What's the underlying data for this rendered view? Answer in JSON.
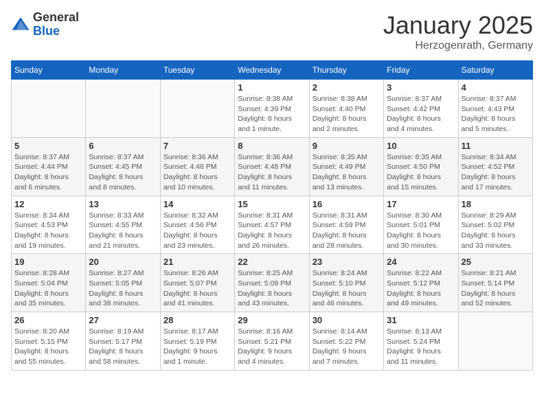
{
  "header": {
    "logo_line1": "General",
    "logo_line2": "Blue",
    "title": "January 2025",
    "subtitle": "Herzogenrath, Germany"
  },
  "weekdays": [
    "Sunday",
    "Monday",
    "Tuesday",
    "Wednesday",
    "Thursday",
    "Friday",
    "Saturday"
  ],
  "weeks": [
    {
      "days": [
        {
          "number": "",
          "info": "",
          "empty": true
        },
        {
          "number": "",
          "info": "",
          "empty": true
        },
        {
          "number": "",
          "info": "",
          "empty": true
        },
        {
          "number": "1",
          "info": "Sunrise: 8:38 AM\nSunset: 4:39 PM\nDaylight: 8 hours\nand 1 minute."
        },
        {
          "number": "2",
          "info": "Sunrise: 8:38 AM\nSunset: 4:40 PM\nDaylight: 8 hours\nand 2 minutes."
        },
        {
          "number": "3",
          "info": "Sunrise: 8:37 AM\nSunset: 4:42 PM\nDaylight: 8 hours\nand 4 minutes."
        },
        {
          "number": "4",
          "info": "Sunrise: 8:37 AM\nSunset: 4:43 PM\nDaylight: 8 hours\nand 5 minutes."
        }
      ]
    },
    {
      "days": [
        {
          "number": "5",
          "info": "Sunrise: 8:37 AM\nSunset: 4:44 PM\nDaylight: 8 hours\nand 6 minutes."
        },
        {
          "number": "6",
          "info": "Sunrise: 8:37 AM\nSunset: 4:45 PM\nDaylight: 8 hours\nand 8 minutes."
        },
        {
          "number": "7",
          "info": "Sunrise: 8:36 AM\nSunset: 4:46 PM\nDaylight: 8 hours\nand 10 minutes."
        },
        {
          "number": "8",
          "info": "Sunrise: 8:36 AM\nSunset: 4:48 PM\nDaylight: 8 hours\nand 11 minutes."
        },
        {
          "number": "9",
          "info": "Sunrise: 8:35 AM\nSunset: 4:49 PM\nDaylight: 8 hours\nand 13 minutes."
        },
        {
          "number": "10",
          "info": "Sunrise: 8:35 AM\nSunset: 4:50 PM\nDaylight: 8 hours\nand 15 minutes."
        },
        {
          "number": "11",
          "info": "Sunrise: 8:34 AM\nSunset: 4:52 PM\nDaylight: 8 hours\nand 17 minutes."
        }
      ]
    },
    {
      "days": [
        {
          "number": "12",
          "info": "Sunrise: 8:34 AM\nSunset: 4:53 PM\nDaylight: 8 hours\nand 19 minutes."
        },
        {
          "number": "13",
          "info": "Sunrise: 8:33 AM\nSunset: 4:55 PM\nDaylight: 8 hours\nand 21 minutes."
        },
        {
          "number": "14",
          "info": "Sunrise: 8:32 AM\nSunset: 4:56 PM\nDaylight: 8 hours\nand 23 minutes."
        },
        {
          "number": "15",
          "info": "Sunrise: 8:31 AM\nSunset: 4:57 PM\nDaylight: 8 hours\nand 26 minutes."
        },
        {
          "number": "16",
          "info": "Sunrise: 8:31 AM\nSunset: 4:59 PM\nDaylight: 8 hours\nand 28 minutes."
        },
        {
          "number": "17",
          "info": "Sunrise: 8:30 AM\nSunset: 5:01 PM\nDaylight: 8 hours\nand 30 minutes."
        },
        {
          "number": "18",
          "info": "Sunrise: 8:29 AM\nSunset: 5:02 PM\nDaylight: 8 hours\nand 33 minutes."
        }
      ]
    },
    {
      "days": [
        {
          "number": "19",
          "info": "Sunrise: 8:28 AM\nSunset: 5:04 PM\nDaylight: 8 hours\nand 35 minutes."
        },
        {
          "number": "20",
          "info": "Sunrise: 8:27 AM\nSunset: 5:05 PM\nDaylight: 8 hours\nand 38 minutes."
        },
        {
          "number": "21",
          "info": "Sunrise: 8:26 AM\nSunset: 5:07 PM\nDaylight: 8 hours\nand 41 minutes."
        },
        {
          "number": "22",
          "info": "Sunrise: 8:25 AM\nSunset: 5:09 PM\nDaylight: 8 hours\nand 43 minutes."
        },
        {
          "number": "23",
          "info": "Sunrise: 8:24 AM\nSunset: 5:10 PM\nDaylight: 8 hours\nand 46 minutes."
        },
        {
          "number": "24",
          "info": "Sunrise: 8:22 AM\nSunset: 5:12 PM\nDaylight: 8 hours\nand 49 minutes."
        },
        {
          "number": "25",
          "info": "Sunrise: 8:21 AM\nSunset: 5:14 PM\nDaylight: 8 hours\nand 52 minutes."
        }
      ]
    },
    {
      "days": [
        {
          "number": "26",
          "info": "Sunrise: 8:20 AM\nSunset: 5:15 PM\nDaylight: 8 hours\nand 55 minutes."
        },
        {
          "number": "27",
          "info": "Sunrise: 8:19 AM\nSunset: 5:17 PM\nDaylight: 8 hours\nand 58 minutes."
        },
        {
          "number": "28",
          "info": "Sunrise: 8:17 AM\nSunset: 5:19 PM\nDaylight: 9 hours\nand 1 minute."
        },
        {
          "number": "29",
          "info": "Sunrise: 8:16 AM\nSunset: 5:21 PM\nDaylight: 9 hours\nand 4 minutes."
        },
        {
          "number": "30",
          "info": "Sunrise: 8:14 AM\nSunset: 5:22 PM\nDaylight: 9 hours\nand 7 minutes."
        },
        {
          "number": "31",
          "info": "Sunrise: 8:13 AM\nSunset: 5:24 PM\nDaylight: 9 hours\nand 11 minutes."
        },
        {
          "number": "",
          "info": "",
          "empty": true
        }
      ]
    }
  ]
}
